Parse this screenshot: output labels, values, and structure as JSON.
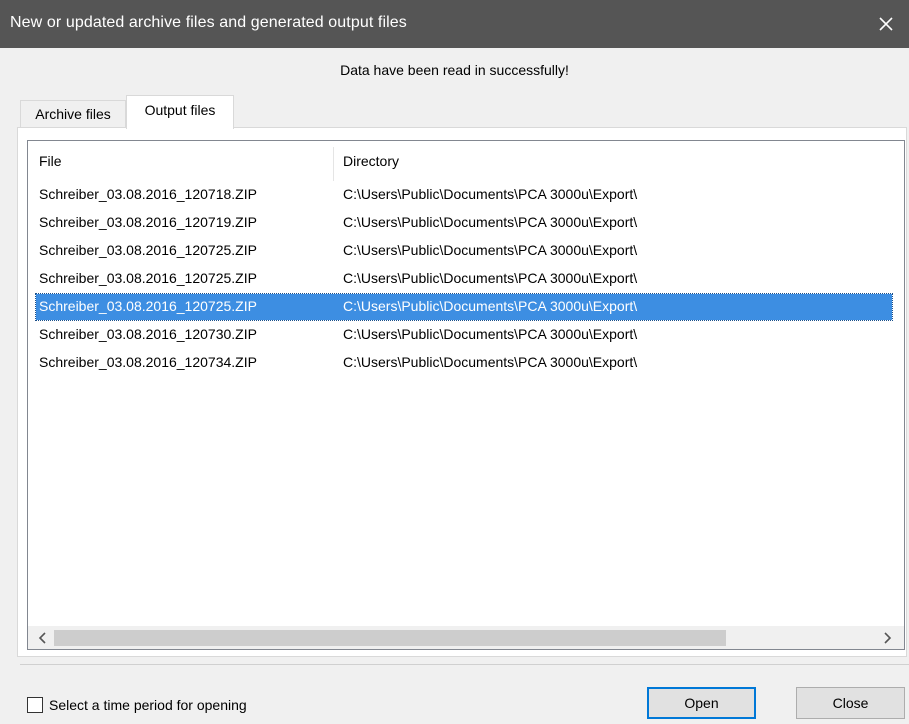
{
  "window": {
    "title": "New or updated archive files and generated output files",
    "close_glyph": "✕"
  },
  "status_message": "Data have been read in successfully!",
  "tabs": [
    {
      "label": "Archive files",
      "active": false
    },
    {
      "label": "Output files",
      "active": true
    }
  ],
  "list": {
    "columns": [
      "File",
      "Directory"
    ],
    "rows": [
      {
        "file": "Schreiber_03.08.2016_120718.ZIP",
        "directory": "C:\\Users\\Public\\Documents\\PCA 3000u\\Export\\",
        "selected": false
      },
      {
        "file": "Schreiber_03.08.2016_120719.ZIP",
        "directory": "C:\\Users\\Public\\Documents\\PCA 3000u\\Export\\",
        "selected": false
      },
      {
        "file": "Schreiber_03.08.2016_120725.ZIP",
        "directory": "C:\\Users\\Public\\Documents\\PCA 3000u\\Export\\",
        "selected": false
      },
      {
        "file": "Schreiber_03.08.2016_120725.ZIP",
        "directory": "C:\\Users\\Public\\Documents\\PCA 3000u\\Export\\",
        "selected": false
      },
      {
        "file": "Schreiber_03.08.2016_120725.ZIP",
        "directory": "C:\\Users\\Public\\Documents\\PCA 3000u\\Export\\",
        "selected": true
      },
      {
        "file": "Schreiber_03.08.2016_120730.ZIP",
        "directory": "C:\\Users\\Public\\Documents\\PCA 3000u\\Export\\",
        "selected": false
      },
      {
        "file": "Schreiber_03.08.2016_120734.ZIP",
        "directory": "C:\\Users\\Public\\Documents\\PCA 3000u\\Export\\",
        "selected": false
      }
    ]
  },
  "scrollbar": {
    "left_arrow": "<",
    "right_arrow": ">"
  },
  "footer": {
    "checkbox_label": "Select a time period for opening",
    "checkbox_checked": false,
    "open_label": "Open",
    "close_label": "Close"
  },
  "colors": {
    "titlebar": "#555555",
    "selection": "#3d8ee2",
    "default_button_border": "#0078d7"
  }
}
